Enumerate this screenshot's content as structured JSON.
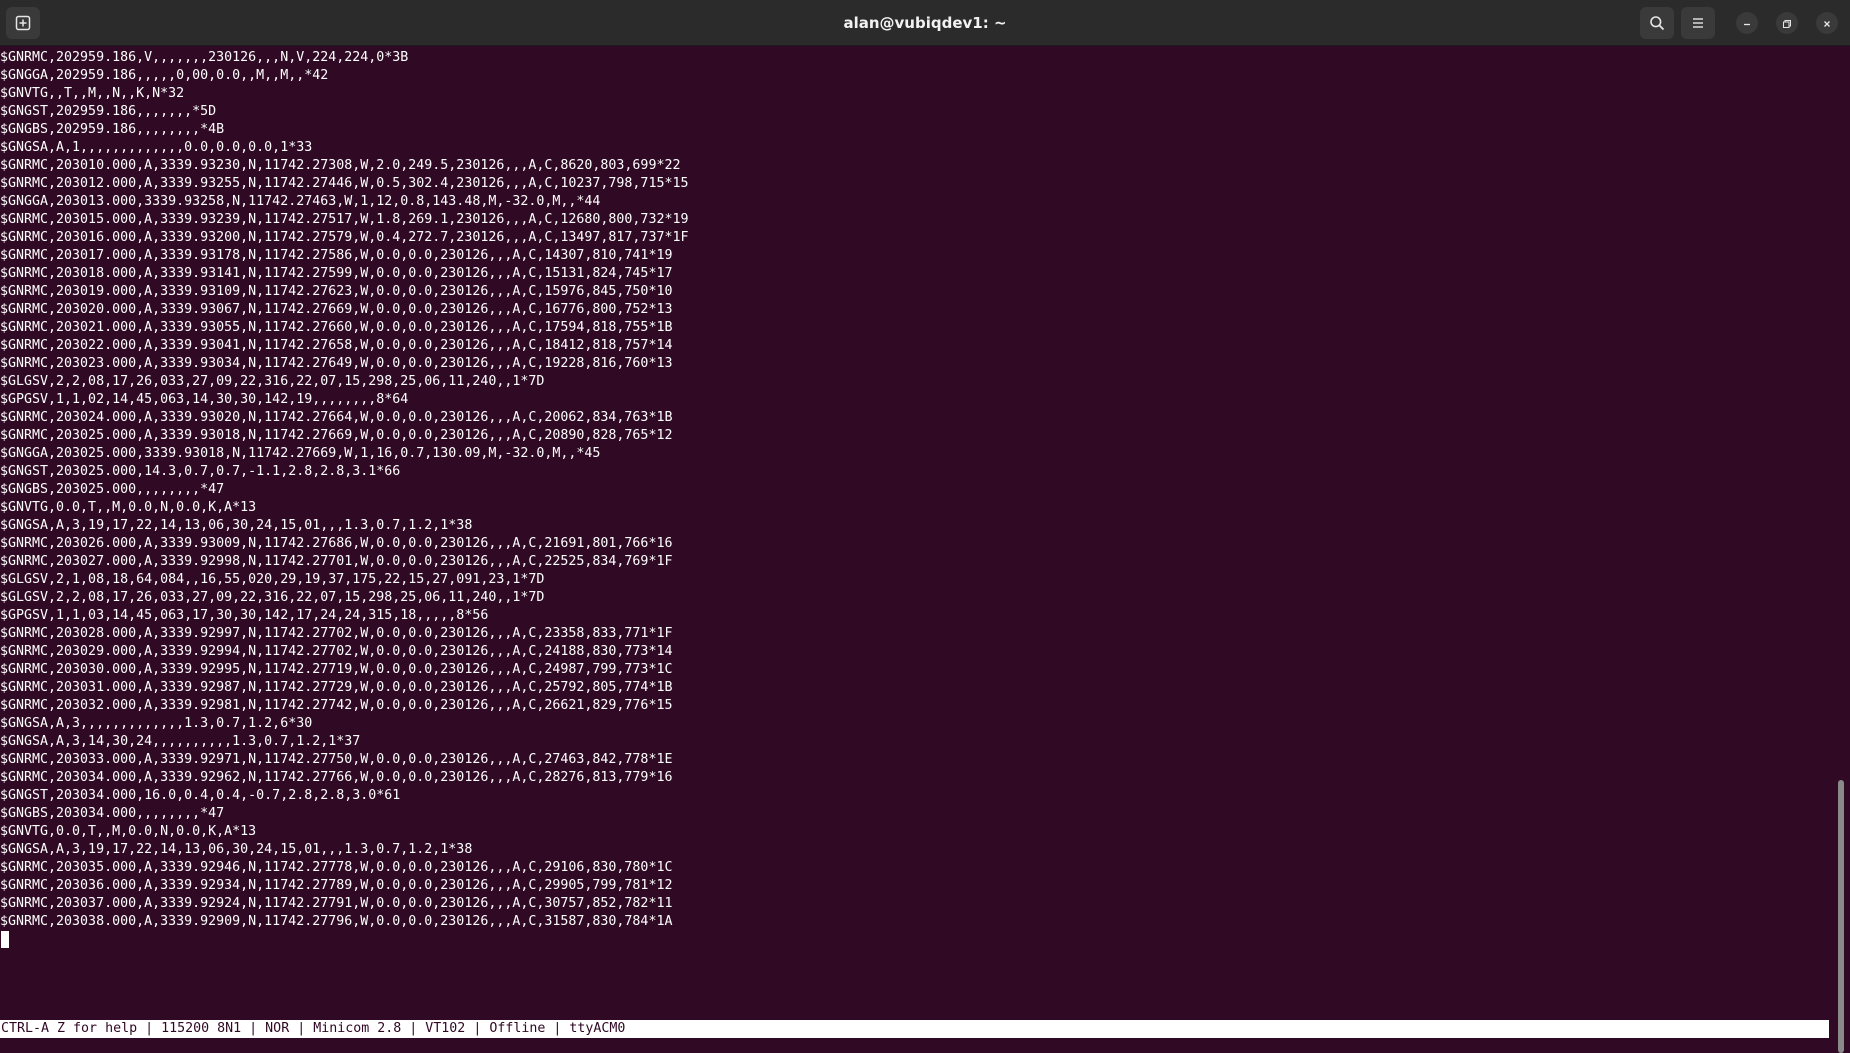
{
  "window": {
    "title": "alan@vubiqdev1: ~",
    "new_tab_icon": "new-tab-icon",
    "search_icon": "search-icon",
    "menu_icon": "hamburger-menu-icon",
    "minimize_icon": "minimize-icon",
    "maximize_icon": "maximize-icon",
    "close_icon": "close-icon"
  },
  "terminal": {
    "lines": [
      "$GNRMC,202959.186,V,,,,,,,230126,,,N,V,224,224,0*3B",
      "$GNGGA,202959.186,,,,,0,00,0.0,,M,,M,,*42",
      "$GNVTG,,T,,M,,N,,K,N*32",
      "$GNGST,202959.186,,,,,,,*5D",
      "$GNGBS,202959.186,,,,,,,,*4B",
      "$GNGSA,A,1,,,,,,,,,,,,,0.0,0.0,0.0,1*33",
      "$GNRMC,203010.000,A,3339.93230,N,11742.27308,W,2.0,249.5,230126,,,A,C,8620,803,699*22",
      "$GNRMC,203012.000,A,3339.93255,N,11742.27446,W,0.5,302.4,230126,,,A,C,10237,798,715*15",
      "$GNGGA,203013.000,3339.93258,N,11742.27463,W,1,12,0.8,143.48,M,-32.0,M,,*44",
      "$GNRMC,203015.000,A,3339.93239,N,11742.27517,W,1.8,269.1,230126,,,A,C,12680,800,732*19",
      "$GNRMC,203016.000,A,3339.93200,N,11742.27579,W,0.4,272.7,230126,,,A,C,13497,817,737*1F",
      "$GNRMC,203017.000,A,3339.93178,N,11742.27586,W,0.0,0.0,230126,,,A,C,14307,810,741*19",
      "$GNRMC,203018.000,A,3339.93141,N,11742.27599,W,0.0,0.0,230126,,,A,C,15131,824,745*17",
      "$GNRMC,203019.000,A,3339.93109,N,11742.27623,W,0.0,0.0,230126,,,A,C,15976,845,750*10",
      "$GNRMC,203020.000,A,3339.93067,N,11742.27669,W,0.0,0.0,230126,,,A,C,16776,800,752*13",
      "$GNRMC,203021.000,A,3339.93055,N,11742.27660,W,0.0,0.0,230126,,,A,C,17594,818,755*1B",
      "$GNRMC,203022.000,A,3339.93041,N,11742.27658,W,0.0,0.0,230126,,,A,C,18412,818,757*14",
      "$GNRMC,203023.000,A,3339.93034,N,11742.27649,W,0.0,0.0,230126,,,A,C,19228,816,760*13",
      "$GLGSV,2,2,08,17,26,033,27,09,22,316,22,07,15,298,25,06,11,240,,1*7D",
      "$GPGSV,1,1,02,14,45,063,14,30,30,142,19,,,,,,,,8*64",
      "$GNRMC,203024.000,A,3339.93020,N,11742.27664,W,0.0,0.0,230126,,,A,C,20062,834,763*1B",
      "$GNRMC,203025.000,A,3339.93018,N,11742.27669,W,0.0,0.0,230126,,,A,C,20890,828,765*12",
      "$GNGGA,203025.000,3339.93018,N,11742.27669,W,1,16,0.7,130.09,M,-32.0,M,,*45",
      "$GNGST,203025.000,14.3,0.7,0.7,-1.1,2.8,2.8,3.1*66",
      "$GNGBS,203025.000,,,,,,,,*47",
      "$GNVTG,0.0,T,,M,0.0,N,0.0,K,A*13",
      "$GNGSA,A,3,19,17,22,14,13,06,30,24,15,01,,,1.3,0.7,1.2,1*38",
      "$GNRMC,203026.000,A,3339.93009,N,11742.27686,W,0.0,0.0,230126,,,A,C,21691,801,766*16",
      "$GNRMC,203027.000,A,3339.92998,N,11742.27701,W,0.0,0.0,230126,,,A,C,22525,834,769*1F",
      "$GLGSV,2,1,08,18,64,084,,16,55,020,29,19,37,175,22,15,27,091,23,1*7D",
      "$GLGSV,2,2,08,17,26,033,27,09,22,316,22,07,15,298,25,06,11,240,,1*7D",
      "$GPGSV,1,1,03,14,45,063,17,30,30,142,17,24,24,315,18,,,,,8*56",
      "$GNRMC,203028.000,A,3339.92997,N,11742.27702,W,0.0,0.0,230126,,,A,C,23358,833,771*1F",
      "$GNRMC,203029.000,A,3339.92994,N,11742.27702,W,0.0,0.0,230126,,,A,C,24188,830,773*14",
      "$GNRMC,203030.000,A,3339.92995,N,11742.27719,W,0.0,0.0,230126,,,A,C,24987,799,773*1C",
      "$GNRMC,203031.000,A,3339.92987,N,11742.27729,W,0.0,0.0,230126,,,A,C,25792,805,774*1B",
      "$GNRMC,203032.000,A,3339.92981,N,11742.27742,W,0.0,0.0,230126,,,A,C,26621,829,776*15",
      "$GNGSA,A,3,,,,,,,,,,,,,1.3,0.7,1.2,6*30",
      "$GNGSA,A,3,14,30,24,,,,,,,,,,1.3,0.7,1.2,1*37",
      "$GNRMC,203033.000,A,3339.92971,N,11742.27750,W,0.0,0.0,230126,,,A,C,27463,842,778*1E",
      "$GNRMC,203034.000,A,3339.92962,N,11742.27766,W,0.0,0.0,230126,,,A,C,28276,813,779*16",
      "$GNGST,203034.000,16.0,0.4,0.4,-0.7,2.8,2.8,3.0*61",
      "$GNGBS,203034.000,,,,,,,,*47",
      "$GNVTG,0.0,T,,M,0.0,N,0.0,K,A*13",
      "$GNGSA,A,3,19,17,22,14,13,06,30,24,15,01,,,1.3,0.7,1.2,1*38",
      "$GNRMC,203035.000,A,3339.92946,N,11742.27778,W,0.0,0.0,230126,,,A,C,29106,830,780*1C",
      "$GNRMC,203036.000,A,3339.92934,N,11742.27789,W,0.0,0.0,230126,,,A,C,29905,799,781*12",
      "$GNRMC,203037.000,A,3339.92924,N,11742.27791,W,0.0,0.0,230126,,,A,C,30757,852,782*11",
      "$GNRMC,203038.000,A,3339.92909,N,11742.27796,W,0.0,0.0,230126,,,A,C,31587,830,784*1A"
    ]
  },
  "statusbar": {
    "text": "CTRL-A Z for help | 115200 8N1 | NOR | Minicom 2.8 | VT102 | Offline | ttyACM0"
  },
  "colors": {
    "terminal_bg": "#300a24",
    "terminal_fg": "#ffffff",
    "titlebar_bg": "#2b2b2b"
  }
}
